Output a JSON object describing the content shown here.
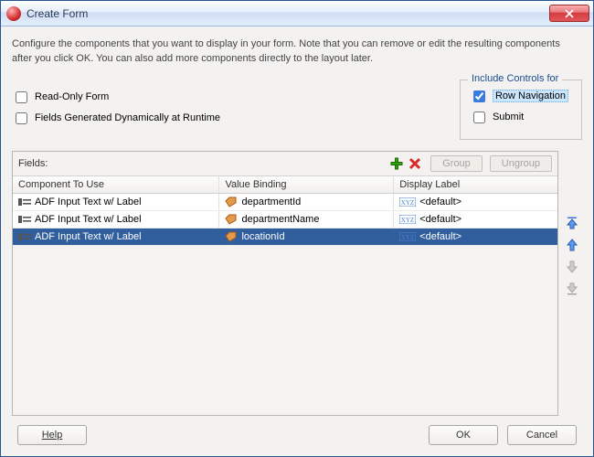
{
  "window": {
    "title": "Create Form"
  },
  "description": "Configure the components that you want to display in your form. Note that you can remove or edit the resulting components after you click OK. You can also add more components directly to the layout later.",
  "options": {
    "readonly_label": "Read-Only Form",
    "dynamic_label": "Fields Generated Dynamically at Runtime"
  },
  "include_controls": {
    "legend": "Include Controls for",
    "row_nav_label": "Row Navigation",
    "submit_label": "Submit",
    "row_nav_checked": true,
    "submit_checked": false
  },
  "fields_panel": {
    "label": "Fields:",
    "group_label": "Group",
    "ungroup_label": "Ungroup",
    "columns": {
      "component": "Component To Use",
      "binding": "Value Binding",
      "display": "Display Label"
    },
    "rows": [
      {
        "component": "ADF Input Text w/ Label",
        "binding": "departmentId",
        "display": "<default>",
        "selected": false
      },
      {
        "component": "ADF Input Text w/ Label",
        "binding": "departmentName",
        "display": "<default>",
        "selected": false
      },
      {
        "component": "ADF Input Text w/ Label",
        "binding": "locationId",
        "display": "<default>",
        "selected": true
      }
    ]
  },
  "buttons": {
    "help": "Help",
    "ok": "OK",
    "cancel": "Cancel"
  }
}
